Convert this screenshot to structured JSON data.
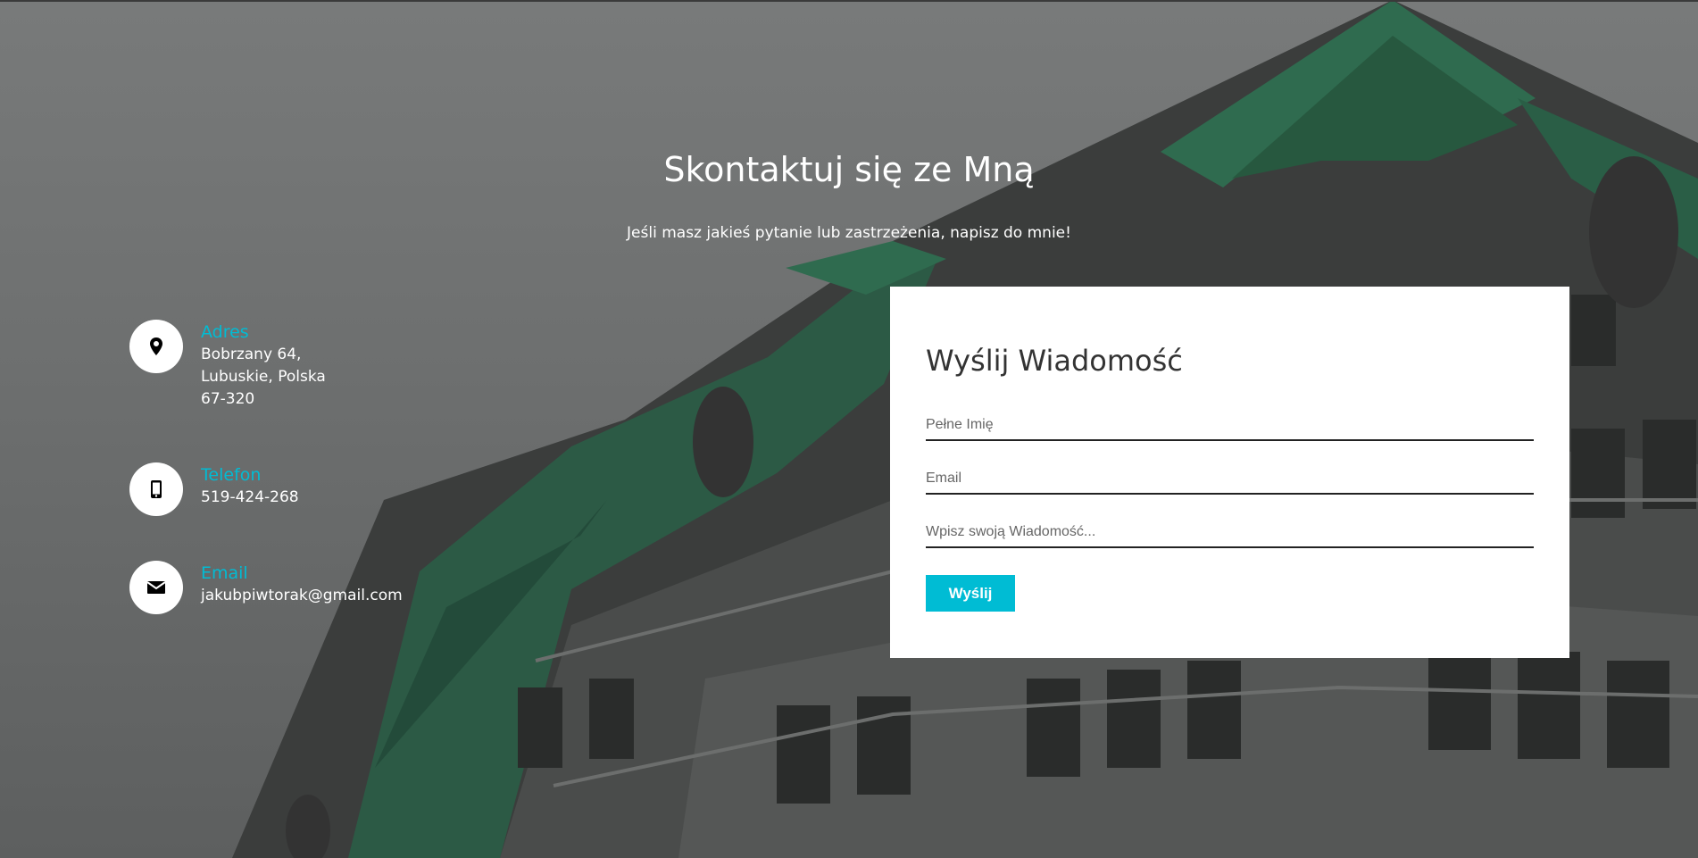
{
  "header": {
    "title": "Skontaktuj się ze Mną",
    "subtitle": "Jeśli masz jakieś pytanie lub zastrzeżenia, napisz do mnie!"
  },
  "contact_info": {
    "address": {
      "label": "Adres",
      "lines": [
        "Bobrzany 64,",
        "Lubuskie, Polska",
        "67-320"
      ],
      "icon": "map-pin-icon"
    },
    "phone": {
      "label": "Telefon",
      "value": "519-424-268",
      "icon": "mobile-phone-icon"
    },
    "email": {
      "label": "Email",
      "value": "jakubpiwtorak@gmail.com",
      "icon": "envelope-icon"
    }
  },
  "form": {
    "title": "Wyślij Wiadomość",
    "name_placeholder": "Pełne Imię",
    "email_placeholder": "Email",
    "message_placeholder": "Wpisz swoją Wiadomość...",
    "name_value": "",
    "email_value": "",
    "message_value": "",
    "submit_label": "Wyślij"
  },
  "colors": {
    "accent": "#00bcd4",
    "background_overlay": "#6f7171",
    "card": "#ffffff",
    "roof_green": "#2f6b4f"
  }
}
